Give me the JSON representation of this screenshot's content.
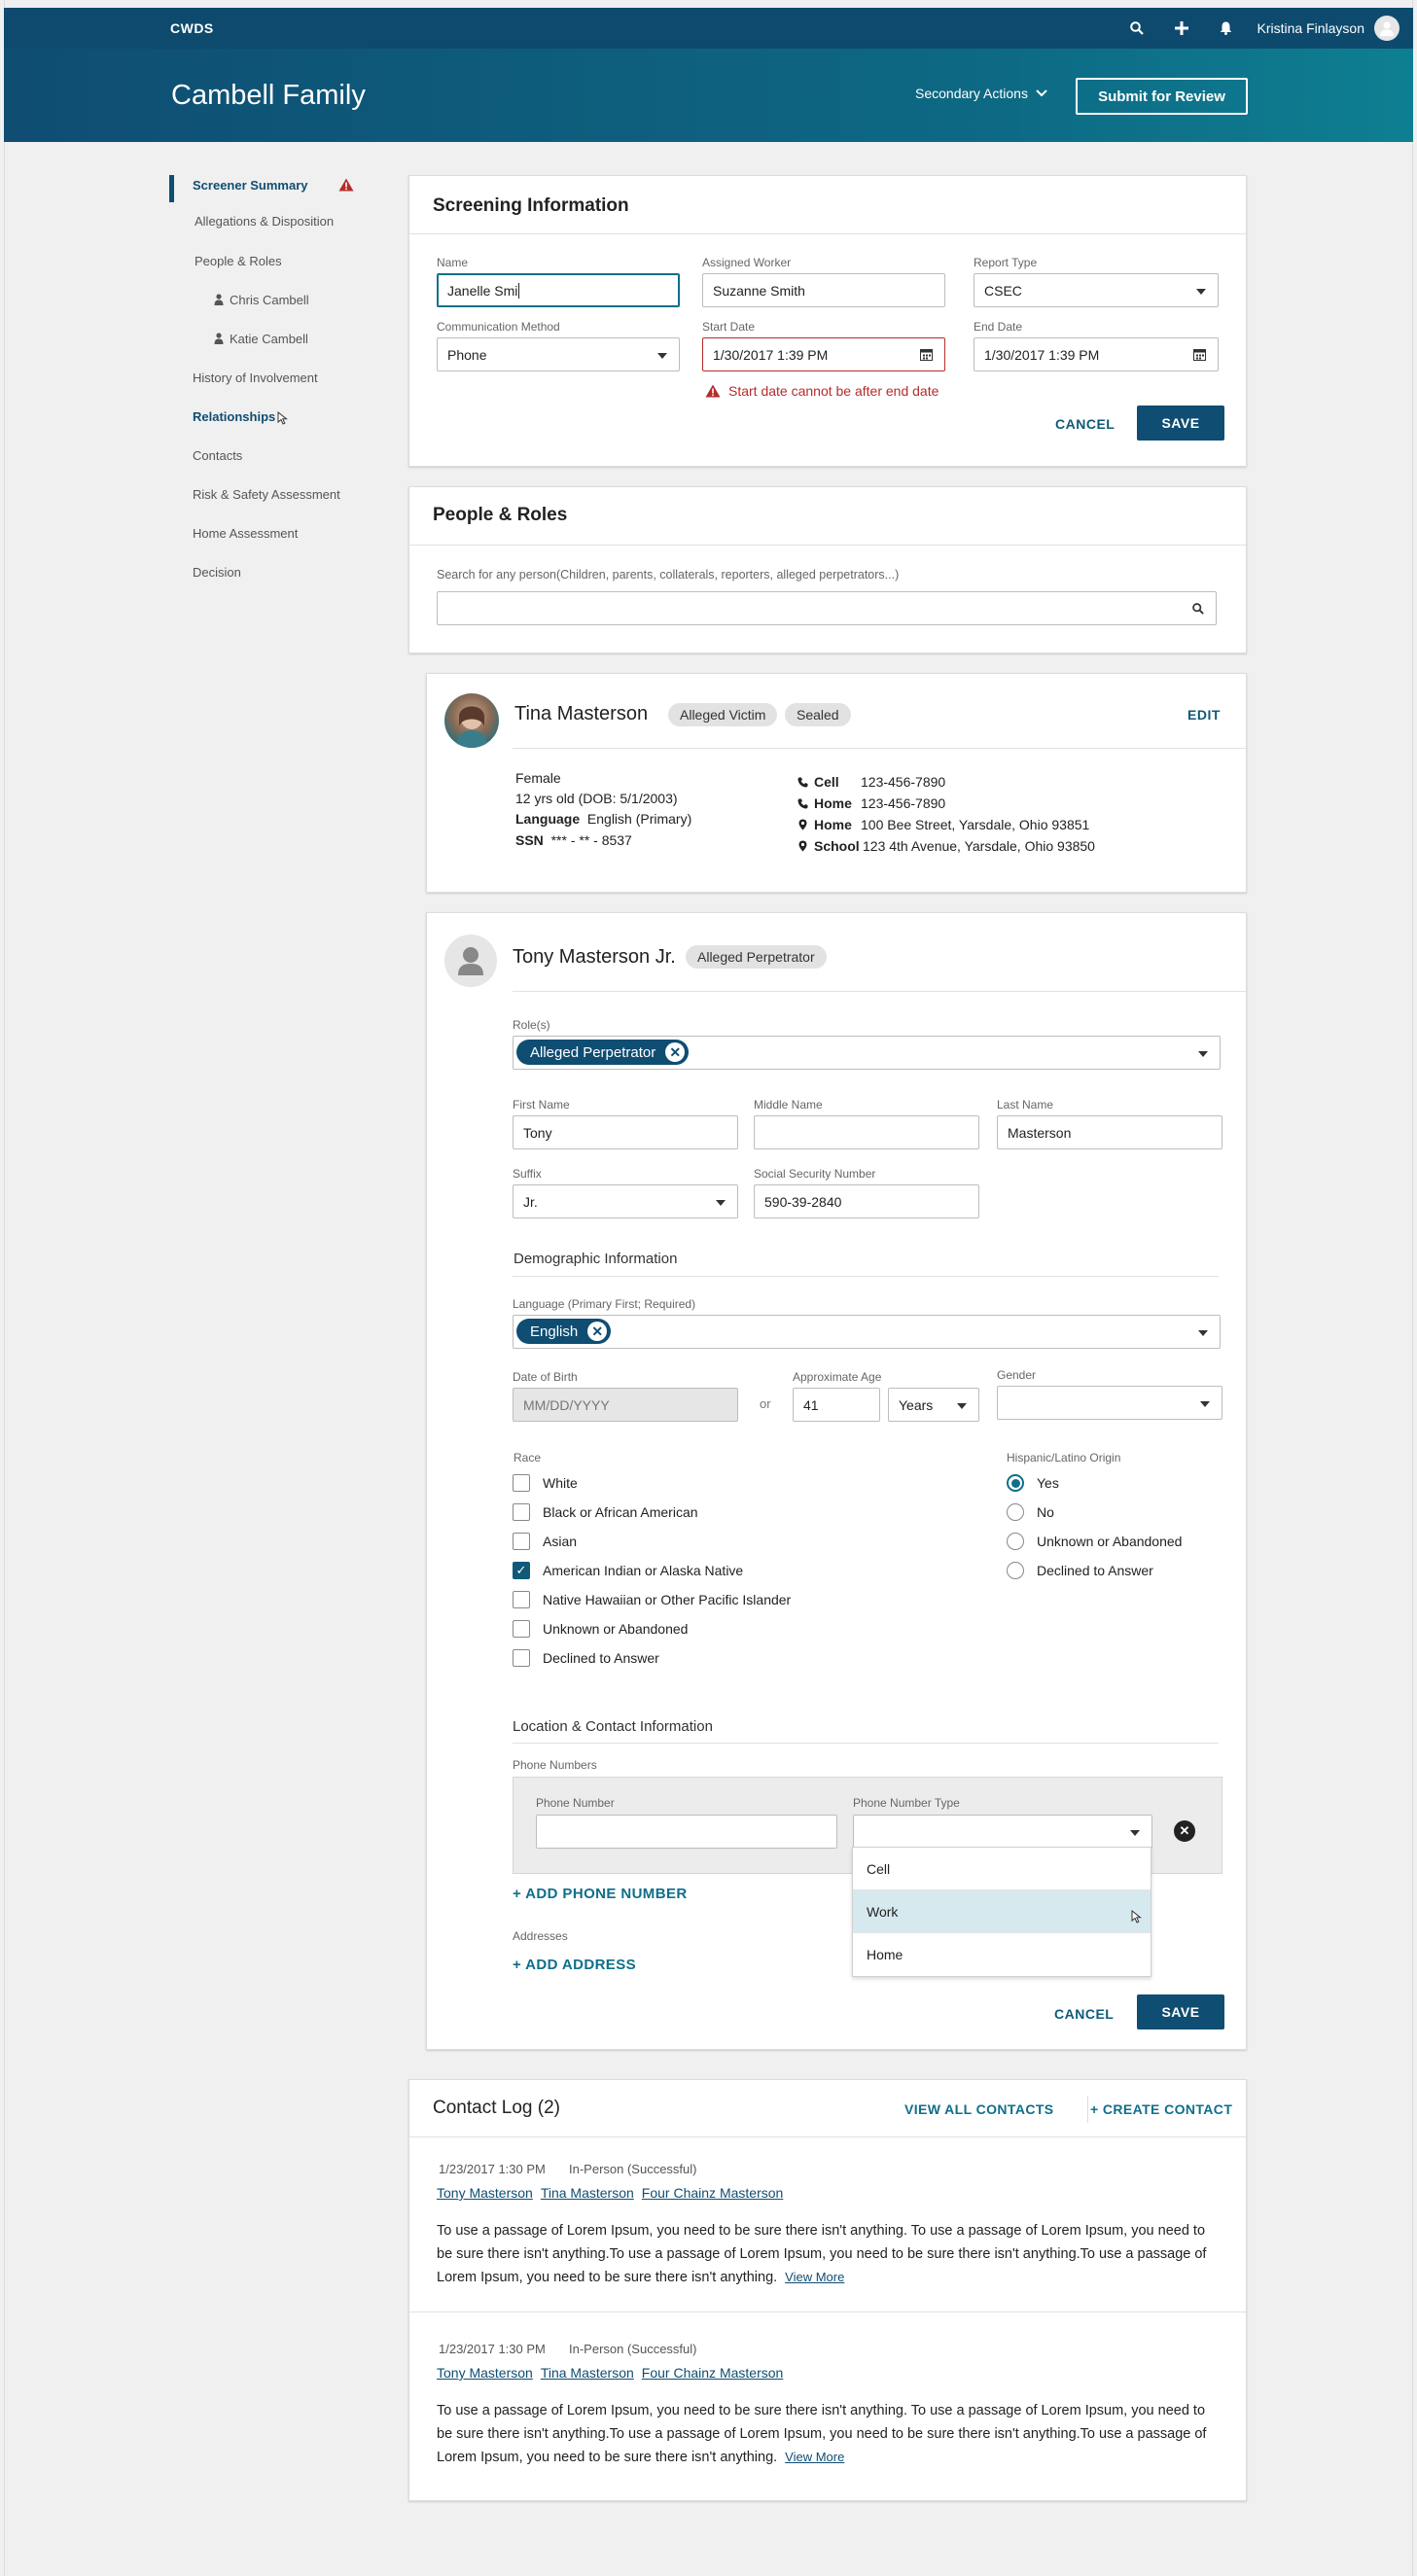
{
  "topbar": {
    "brand": "CWDS",
    "user_name": "Kristina Finlayson"
  },
  "header": {
    "title": "Cambell Family",
    "secondary_actions": "Secondary Actions",
    "submit_label": "Submit for Review"
  },
  "sidebar": {
    "items": [
      {
        "label": "Screener Summary"
      },
      {
        "label": "Allegations & Disposition"
      },
      {
        "label": "People & Roles"
      },
      {
        "label": "Chris Cambell"
      },
      {
        "label": "Katie Cambell"
      },
      {
        "label": "History of Involvement"
      },
      {
        "label": "Relationships"
      },
      {
        "label": "Contacts"
      },
      {
        "label": "Risk & Safety Assessment"
      },
      {
        "label": "Home Assessment"
      },
      {
        "label": "Decision"
      }
    ]
  },
  "screening": {
    "title": "Screening Information",
    "name_label": "Name",
    "name_value": "Janelle Smi",
    "worker_label": "Assigned Worker",
    "worker_value": "Suzanne Smith",
    "report_label": "Report Type",
    "report_value": "CSEC",
    "comm_label": "Communication Method",
    "comm_value": "Phone",
    "start_label": "Start Date",
    "start_value": "1/30/2017 1:39 PM",
    "end_label": "End Date",
    "end_value": "1/30/2017 1:39 PM",
    "error": "Start date cannot be after end date",
    "cancel": "CANCEL",
    "save": "SAVE"
  },
  "people_roles": {
    "title": "People & Roles",
    "search_label": "Search for any person(Children, parents, collaterals, reporters, alleged perpetrators...)"
  },
  "tina": {
    "name": "Tina Masterson",
    "badge1": "Alleged Victim",
    "badge2": "Sealed",
    "edit": "EDIT",
    "gender": "Female",
    "age": "12 yrs old (DOB: 5/1/2003)",
    "language_label": "Language",
    "language_value": "English (Primary)",
    "ssn_label": "SSN",
    "ssn_value": "*** - ** - 8537",
    "contacts": [
      {
        "label": "Cell",
        "value": "123-456-7890"
      },
      {
        "label": "Home",
        "value": "123-456-7890"
      },
      {
        "label": "Home",
        "value": "100 Bee Street, Yarsdale, Ohio 93851"
      },
      {
        "label": "School",
        "value": "123 4th Avenue, Yarsdale, Ohio 93850"
      }
    ]
  },
  "tony": {
    "name": "Tony Masterson Jr.",
    "badge": "Alleged Perpetrator",
    "roles_label": "Role(s)",
    "role_chip": "Alleged Perpetrator",
    "first_label": "First Name",
    "first_value": "Tony",
    "middle_label": "Middle Name",
    "middle_value": "",
    "last_label": "Last Name",
    "last_value": "Masterson",
    "suffix_label": "Suffix",
    "suffix_value": "Jr.",
    "ssn_label": "Social Security Number",
    "ssn_value": "590-39-2840",
    "demo_head": "Demographic Information",
    "lang_label": "Language (Primary First; Required)",
    "lang_chip": "English",
    "dob_label": "Date of Birth",
    "dob_placeholder": "MM/DD/YYYY",
    "or": "or",
    "age_label": "Approximate Age",
    "age_value": "41",
    "age_unit": "Years",
    "gender_label": "Gender",
    "gender_value": "",
    "race_label": "Race",
    "race_options": [
      {
        "label": "White",
        "checked": false
      },
      {
        "label": "Black or African American",
        "checked": false
      },
      {
        "label": "Asian",
        "checked": false
      },
      {
        "label": "American Indian or Alaska Native",
        "checked": true
      },
      {
        "label": "Native Hawaiian or Other Pacific Islander",
        "checked": false
      },
      {
        "label": "Unknown or Abandoned",
        "checked": false
      },
      {
        "label": "Declined to Answer",
        "checked": false
      }
    ],
    "hispanic_label": "Hispanic/Latino Origin",
    "hispanic_options": [
      {
        "label": "Yes",
        "checked": true
      },
      {
        "label": "No",
        "checked": false
      },
      {
        "label": "Unknown or Abandoned",
        "checked": false
      },
      {
        "label": "Declined to Answer",
        "checked": false
      }
    ],
    "loc_head": "Location & Contact Information",
    "phones_label": "Phone Numbers",
    "phone_num_label": "Phone Number",
    "phone_type_label": "Phone Number Type",
    "phone_type_options": [
      "Cell",
      "Work",
      "Home"
    ],
    "add_phone": "+ ADD PHONE NUMBER",
    "addresses_label": "Addresses",
    "add_address": "+ ADD ADDRESS",
    "cancel": "CANCEL",
    "save": "SAVE"
  },
  "contact_log": {
    "title": "Contact Log (2)",
    "view_all": "VIEW ALL CONTACTS",
    "create": "+ CREATE CONTACT",
    "entries": [
      {
        "date": "1/23/2017 1:30 PM",
        "type": "In-Person (Successful)",
        "people": [
          "Tony Masterson",
          "Tina Masterson",
          "Four Chainz Masterson"
        ],
        "text": "To use a passage of Lorem Ipsum, you need to be sure there isn't anything. To use a passage of Lorem Ipsum, you need to be sure there isn't anything.To use a passage of Lorem Ipsum, you need to be sure there isn't anything.To use a passage of Lorem Ipsum, you need to be sure there isn't anything.",
        "more": "View More"
      },
      {
        "date": "1/23/2017 1:30 PM",
        "type": "In-Person (Successful)",
        "people": [
          "Tony Masterson",
          "Tina Masterson",
          "Four Chainz Masterson"
        ],
        "text": "To use a passage of Lorem Ipsum, you need to be sure there isn't anything. To use a passage of Lorem Ipsum, you need to be sure there isn't anything.To use a passage of Lorem Ipsum, you need to be sure there isn't anything.To use a passage of Lorem Ipsum, you need to be sure there isn't anything.",
        "more": "View More"
      }
    ]
  },
  "colors": {
    "primary": "#0f4d72",
    "teal": "#0e7f92",
    "error": "#b72b2b"
  }
}
